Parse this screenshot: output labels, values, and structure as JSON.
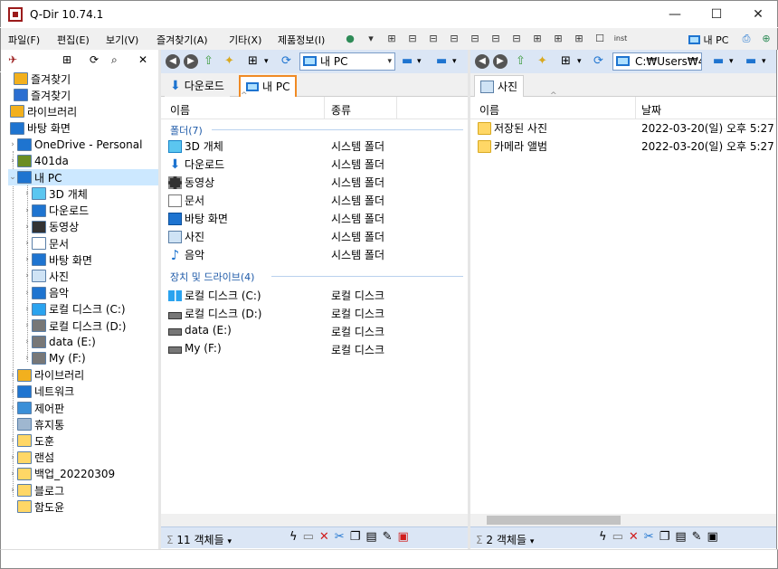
{
  "window": {
    "title": "Q-Dir 10.74.1",
    "minimize": "—",
    "maximize": "☐",
    "close": "✕"
  },
  "menu": {
    "items": [
      "파일(F)",
      "편집(E)",
      "보기(V)",
      "즐겨찾기(A)",
      "기타(X)",
      "제품정보(I)"
    ],
    "inst_label": "inst",
    "pc_label": "내 PC"
  },
  "tree": {
    "items": [
      {
        "label": "즐겨찾기",
        "icon": "star-icon",
        "color": "#f2b01e"
      },
      {
        "label": "즐겨찾기",
        "icon": "star-icon",
        "color": "#2b6fd1"
      },
      {
        "label": "라이브러리",
        "icon": "library-icon",
        "color": "#f2b01e"
      },
      {
        "label": "바탕 화면",
        "icon": "desktop-icon",
        "color": "#1e74d0"
      },
      {
        "label": "OneDrive - Personal",
        "icon": "cloud-icon",
        "color": "#1e74d0"
      },
      {
        "label": "401da",
        "icon": "user-icon",
        "color": "#6b8e23"
      },
      {
        "label": "내 PC",
        "icon": "pc-icon",
        "color": "#1e74d0"
      },
      {
        "label": "3D 개체",
        "icon": "cube-icon",
        "color": "#5bc6f0"
      },
      {
        "label": "다운로드",
        "icon": "download-icon",
        "color": "#1e74d0"
      },
      {
        "label": "동영상",
        "icon": "film-icon",
        "color": "#333333"
      },
      {
        "label": "문서",
        "icon": "document-icon",
        "color": "#ffffff"
      },
      {
        "label": "바탕 화면",
        "icon": "desktop-icon",
        "color": "#1e74d0"
      },
      {
        "label": "사진",
        "icon": "picture-icon",
        "color": "#cfe3f5"
      },
      {
        "label": "음악",
        "icon": "music-icon",
        "color": "#1e74d0"
      },
      {
        "label": "로컬 디스크 (C:)",
        "icon": "windows-drive-icon",
        "color": "#2aa3ef"
      },
      {
        "label": "로컬 디스크 (D:)",
        "icon": "drive-icon",
        "color": "#777777"
      },
      {
        "label": "data (E:)",
        "icon": "drive-icon",
        "color": "#777777"
      },
      {
        "label": "My (F:)",
        "icon": "drive-icon",
        "color": "#777777"
      },
      {
        "label": "라이브러리",
        "icon": "library-icon",
        "color": "#f2b01e"
      },
      {
        "label": "네트워크",
        "icon": "network-icon",
        "color": "#1e74d0"
      },
      {
        "label": "제어판",
        "icon": "control-panel-icon",
        "color": "#3a8fd8"
      },
      {
        "label": "휴지통",
        "icon": "recycle-bin-icon",
        "color": "#9fb7d0"
      },
      {
        "label": "도훈",
        "icon": "folder-icon",
        "color": "#ffd766"
      },
      {
        "label": "랜섬",
        "icon": "folder-icon",
        "color": "#ffd766"
      },
      {
        "label": "백업_20220309",
        "icon": "folder-icon",
        "color": "#ffd766"
      },
      {
        "label": "블로그",
        "icon": "folder-icon",
        "color": "#ffd766"
      },
      {
        "label": "함도윤",
        "icon": "folder-icon",
        "color": "#ffd766"
      }
    ]
  },
  "pane1": {
    "address": "내 PC",
    "tabs": [
      "다운로드",
      "내 PC"
    ],
    "columns": {
      "name": "이름",
      "type": "종류"
    },
    "group_folders": "폴더(7)",
    "group_drives": "장치 및 드라이브(4)",
    "folders": [
      {
        "name": "3D 개체",
        "type": "시스템 폴더",
        "icon": "cube-icon"
      },
      {
        "name": "다운로드",
        "type": "시스템 폴더",
        "icon": "download-icon"
      },
      {
        "name": "동영상",
        "type": "시스템 폴더",
        "icon": "film-icon"
      },
      {
        "name": "문서",
        "type": "시스템 폴더",
        "icon": "document-icon"
      },
      {
        "name": "바탕 화면",
        "type": "시스템 폴더",
        "icon": "desktop-icon"
      },
      {
        "name": "사진",
        "type": "시스템 폴더",
        "icon": "picture-icon"
      },
      {
        "name": "음악",
        "type": "시스템 폴더",
        "icon": "music-icon"
      }
    ],
    "drives": [
      {
        "name": "로컬 디스크 (C:)",
        "type": "로컬 디스크",
        "icon": "windows-drive-icon"
      },
      {
        "name": "로컬 디스크 (D:)",
        "type": "로컬 디스크",
        "icon": "drive-icon"
      },
      {
        "name": "data (E:)",
        "type": "로컬 디스크",
        "icon": "drive-icon"
      },
      {
        "name": "My (F:)",
        "type": "로컬 디스크",
        "icon": "drive-icon"
      }
    ],
    "status": "11 객체들"
  },
  "pane2": {
    "address": "C:₩Users₩4",
    "tabs": [
      "사진"
    ],
    "columns": {
      "name": "이름",
      "date": "날짜"
    },
    "rows": [
      {
        "name": "저장된 사진",
        "date": "2022-03-20(일) 오후 5:27"
      },
      {
        "name": "카메라 앨범",
        "date": "2022-03-20(일) 오후 5:27"
      }
    ],
    "status": "2 객체들"
  },
  "colors": {
    "toolbar_bg": "#dbe6f5",
    "active_tab_border": "#f08a24",
    "selection": "#cce8ff",
    "group_text": "#1e5aa8"
  }
}
